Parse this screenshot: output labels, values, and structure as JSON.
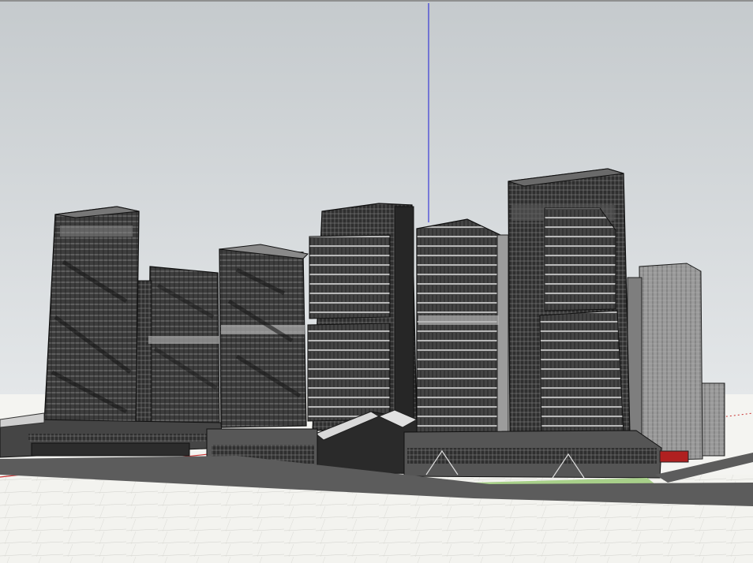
{
  "app": {
    "title": ""
  },
  "viewport": {
    "sky_top_color": "#c5cacd",
    "sky_bottom_color": "#e4e7e9",
    "ground_color": "#f4f4f1",
    "road_color": "#5c5c5c",
    "grass_color": "#a8d08a",
    "building_face_color": "#3a3a3a",
    "building_edge_color": "#111111",
    "z_axis_color": "#1a1ad6",
    "x_axis_color": "#c83232",
    "y_axis_color": "#2e9e2e"
  },
  "model": {
    "name": "",
    "towers": [
      {
        "id": "tower-1"
      },
      {
        "id": "tower-2"
      },
      {
        "id": "tower-3"
      },
      {
        "id": "tower-4"
      },
      {
        "id": "tower-5"
      },
      {
        "id": "tower-6"
      },
      {
        "id": "tower-7"
      }
    ],
    "podium": "podium-block",
    "entrance": "entrance-pavilion"
  }
}
